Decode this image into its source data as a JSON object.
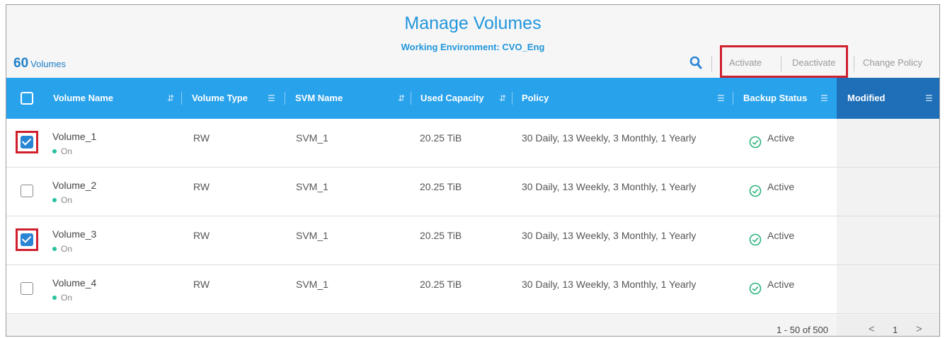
{
  "header": {
    "title": "Manage Volumes",
    "subtitle": "Working Environment: CVO_Eng",
    "count_number": "60",
    "count_unit": "Volumes"
  },
  "toolbar": {
    "activate_label": "Activate",
    "deactivate_label": "Deactivate",
    "change_policy_label": "Change Policy"
  },
  "columns": {
    "volume_name": "Volume Name",
    "volume_type": "Volume Type",
    "svm_name": "SVM Name",
    "used_capacity": "Used Capacity",
    "policy": "Policy",
    "backup_status": "Backup Status",
    "modified": "Modified"
  },
  "icons": {
    "sort": "sort-icon",
    "filter": "filter-icon",
    "search": "search-icon",
    "status": "check-circle-icon"
  },
  "rows": [
    {
      "name": "Volume_1",
      "state": "On",
      "type": "RW",
      "svm": "SVM_1",
      "capacity": "20.25 TiB",
      "policy": "30 Daily, 13 Weekly, 3 Monthly, 1 Yearly",
      "status": "Active",
      "checked": true
    },
    {
      "name": "Volume_2",
      "state": "On",
      "type": "RW",
      "svm": "SVM_1",
      "capacity": "20.25 TiB",
      "policy": "30 Daily, 13 Weekly, 3 Monthly, 1 Yearly",
      "status": "Active",
      "checked": false
    },
    {
      "name": "Volume_3",
      "state": "On",
      "type": "RW",
      "svm": "SVM_1",
      "capacity": "20.25 TiB",
      "policy": "30 Daily, 13 Weekly, 3 Monthly, 1 Yearly",
      "status": "Active",
      "checked": true
    },
    {
      "name": "Volume_4",
      "state": "On",
      "type": "RW",
      "svm": "SVM_1",
      "capacity": "20.25 TiB",
      "policy": "30 Daily, 13 Weekly, 3 Monthly, 1 Yearly",
      "status": "Active",
      "checked": false
    }
  ],
  "pagination": {
    "range": "1 - 50 of 500",
    "page": "1",
    "prev": "<",
    "next": ">"
  },
  "colors": {
    "accent": "#2196dc",
    "header_bar": "#29a2ec",
    "highlight": "#d0202e",
    "status_green": "#27c2a0"
  }
}
